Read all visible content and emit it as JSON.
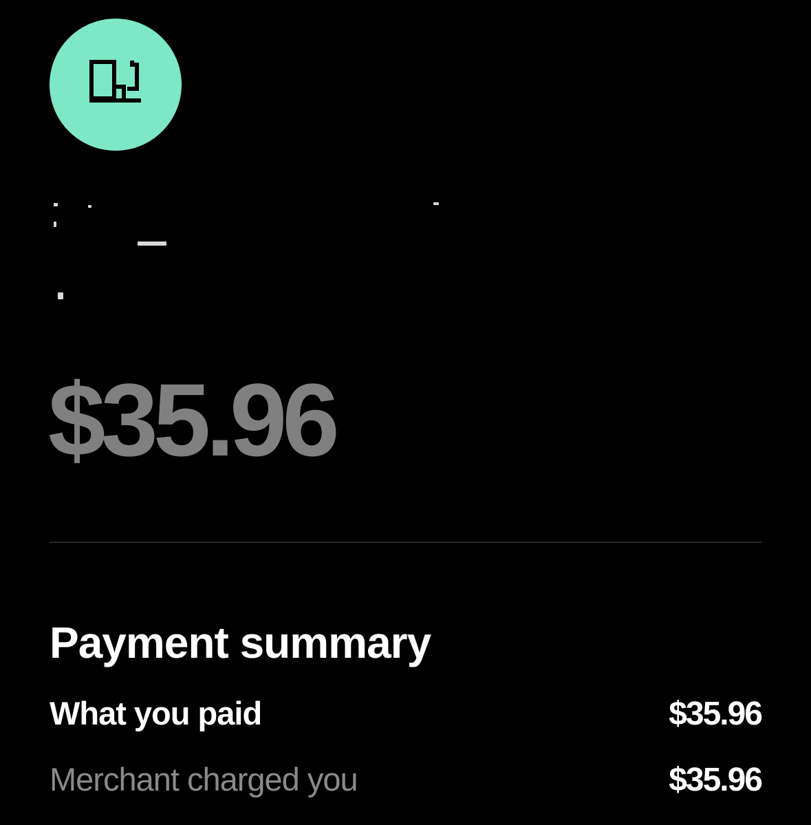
{
  "merchant": {
    "icon": "fuel-pump-icon",
    "avatar_color": "#7ee8c6",
    "name": "",
    "details": ""
  },
  "transaction": {
    "amount": "$35.96"
  },
  "payment_summary": {
    "title": "Payment summary",
    "rows": [
      {
        "label": "What you paid",
        "value": "$35.96"
      },
      {
        "label": "Merchant charged you",
        "value": "$35.96"
      }
    ]
  }
}
